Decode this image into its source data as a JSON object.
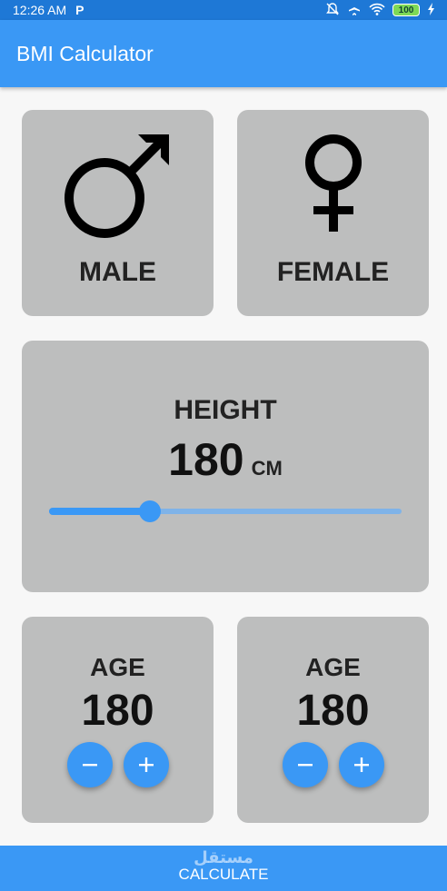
{
  "status_bar": {
    "time": "12:26 AM",
    "carrier_glyph": "P",
    "battery": "100",
    "icons": [
      "bell-off-icon",
      "airplane-icon",
      "wifi-icon",
      "battery-icon",
      "charging-icon"
    ]
  },
  "app_bar": {
    "title": "BMI Calculator"
  },
  "gender": {
    "male_label": "MALE",
    "female_label": "FEMALE",
    "male_icon": "male-symbol-icon",
    "female_icon": "female-symbol-icon"
  },
  "height": {
    "label": "HEIGHT",
    "value": "180",
    "unit": "CM",
    "slider_fraction": 0.285
  },
  "weight": {
    "label": "AGE",
    "value": "180"
  },
  "age": {
    "label": "AGE",
    "value": "180"
  },
  "calculate_label": "CALCULATE",
  "watermark": "مستقل",
  "colors": {
    "accent": "#3a98f5",
    "status_bar": "#1e78d6",
    "card": "#bdbebe",
    "background": "#f7f7f7"
  }
}
